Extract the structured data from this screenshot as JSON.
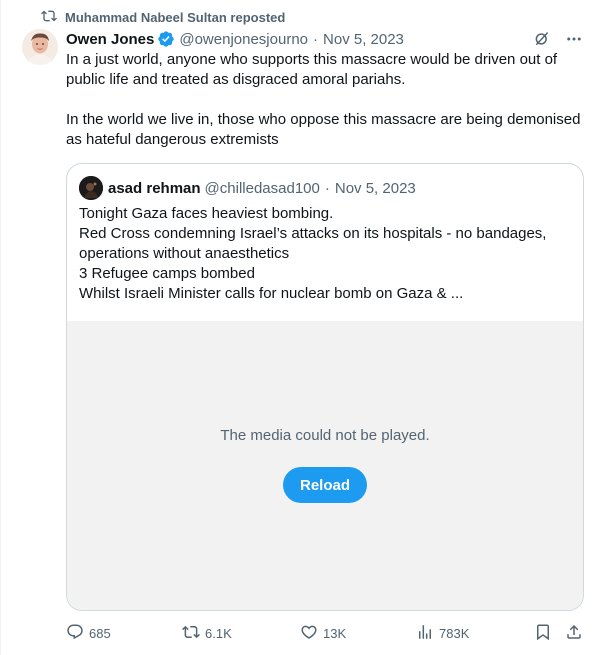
{
  "repost": {
    "text": "Muhammad Nabeel Sultan reposted",
    "icon": "retweet-icon"
  },
  "author": {
    "name": "Owen Jones",
    "handle": "@owenjonesjourno",
    "separator": "·",
    "date": "Nov 5, 2023",
    "verified": true,
    "verified_color": "#1d9bf0"
  },
  "top_actions": [
    "grok-icon",
    "more-icon"
  ],
  "tweet_body": [
    "In a just world, anyone who supports this massacre would be driven out of public life and treated as disgraced amoral pariahs.",
    "In the world we live in, those who oppose this massacre are being demonised as hateful dangerous extremists"
  ],
  "quote": {
    "name": "asad rehman",
    "handle": "@chilledasad100",
    "separator": "·",
    "date": "Nov 5, 2023",
    "lines": [
      "Tonight Gaza faces heaviest bombing.",
      "Red Cross condemning Israel’s attacks on its hospitals - no bandages,",
      "operations without anaesthetics",
      "3 Refugee camps bombed",
      "Whilst Israeli Minister calls for nuclear bomb on Gaza & ..."
    ],
    "media": {
      "message": "The media could not be played.",
      "button_label": "Reload"
    }
  },
  "actions": {
    "replies": "685",
    "reposts": "6.1K",
    "likes": "13K",
    "views": "783K"
  },
  "colors": {
    "accent": "#1d9bf0",
    "secondary_text": "#536471",
    "border": "#cfd9de",
    "media_bg": "#f2f2f2"
  }
}
